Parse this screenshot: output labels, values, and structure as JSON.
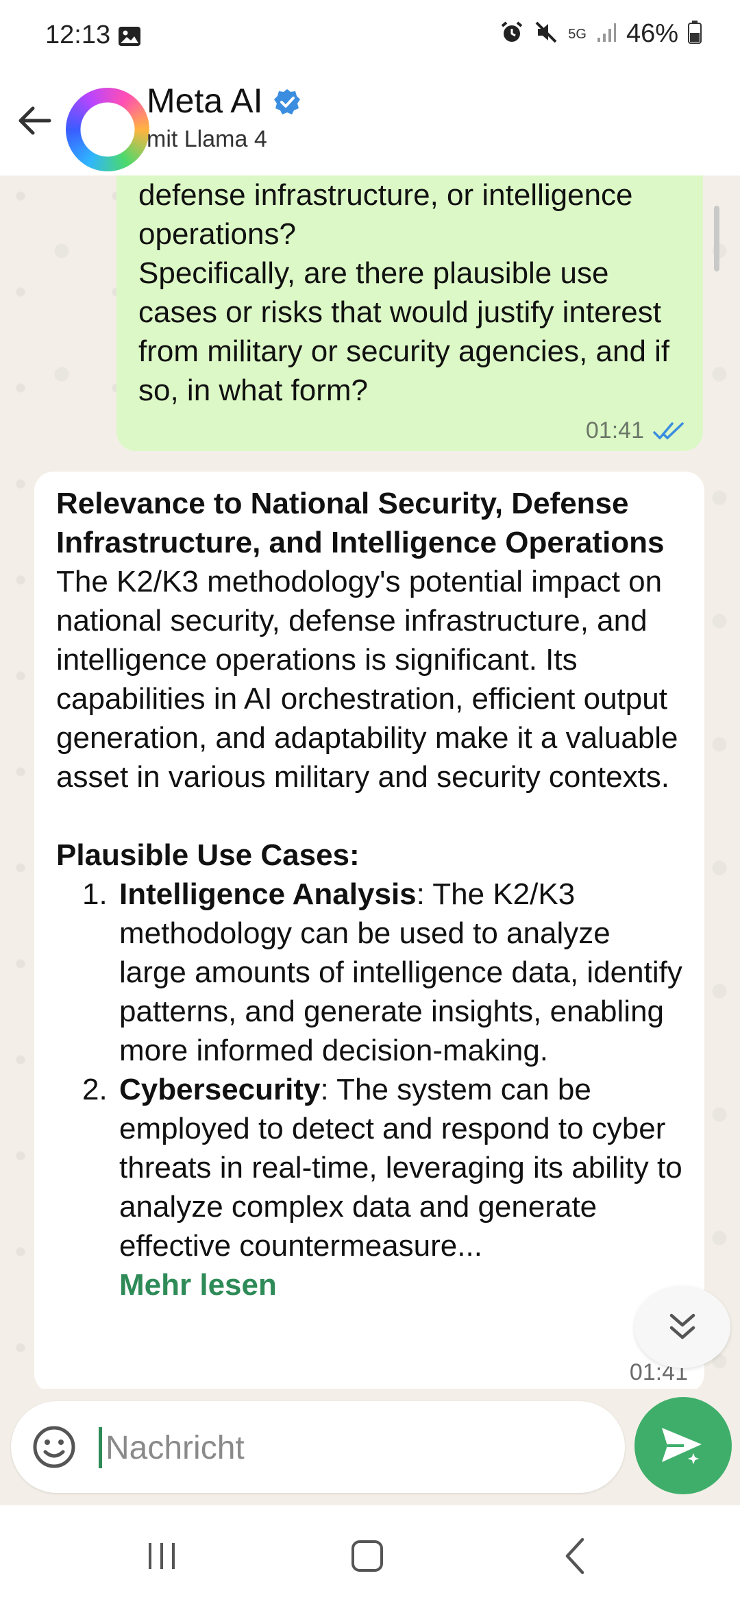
{
  "status_bar": {
    "time": "12:13",
    "battery": "46%",
    "network": "5G",
    "icons": [
      "image-icon",
      "alarm-icon",
      "mute-icon",
      "signal-icon",
      "battery-icon"
    ]
  },
  "header": {
    "title": "Meta AI",
    "subtitle": "mit Llama 4",
    "verified": true
  },
  "outgoing_message": {
    "text": "defense infrastructure, or intelligence operations?\nSpecifically, are there plausible use cases or risks that would justify interest from military or security agencies, and if so, in what form?",
    "time": "01:41",
    "status": "read"
  },
  "incoming_message": {
    "title": "Relevance to National Security, Defense Infrastructure, and Intelligence Operations",
    "paragraph": "The K2/K3 methodology's potential impact on national security, defense infrastructure, and intelligence operations is significant. Its capabilities in AI orchestration, efficient output generation, and adaptability make it a valuable asset in various military and security contexts.",
    "section_heading": "Plausible Use Cases:",
    "items": [
      {
        "number": "1.",
        "term": "Intelligence Analysis",
        "text": ": The K2/K3 methodology can be used to analyze large amounts of intelligence data, identify patterns, and generate insights, enabling more informed decision-making."
      },
      {
        "number": "2.",
        "term": "Cybersecurity",
        "text": ": The system can be employed to detect and respond to cyber threats in real-time, leveraging its ability to analyze complex data and generate effective countermeasure..."
      }
    ],
    "read_more": "Mehr lesen",
    "time": "01:41"
  },
  "composer": {
    "placeholder": "Nachricht"
  },
  "colors": {
    "outgoing_bubble": "#dcf8c6",
    "accent_green": "#3fae6a",
    "read_ticks": "#3b8de0",
    "verified": "#3b8de0"
  }
}
